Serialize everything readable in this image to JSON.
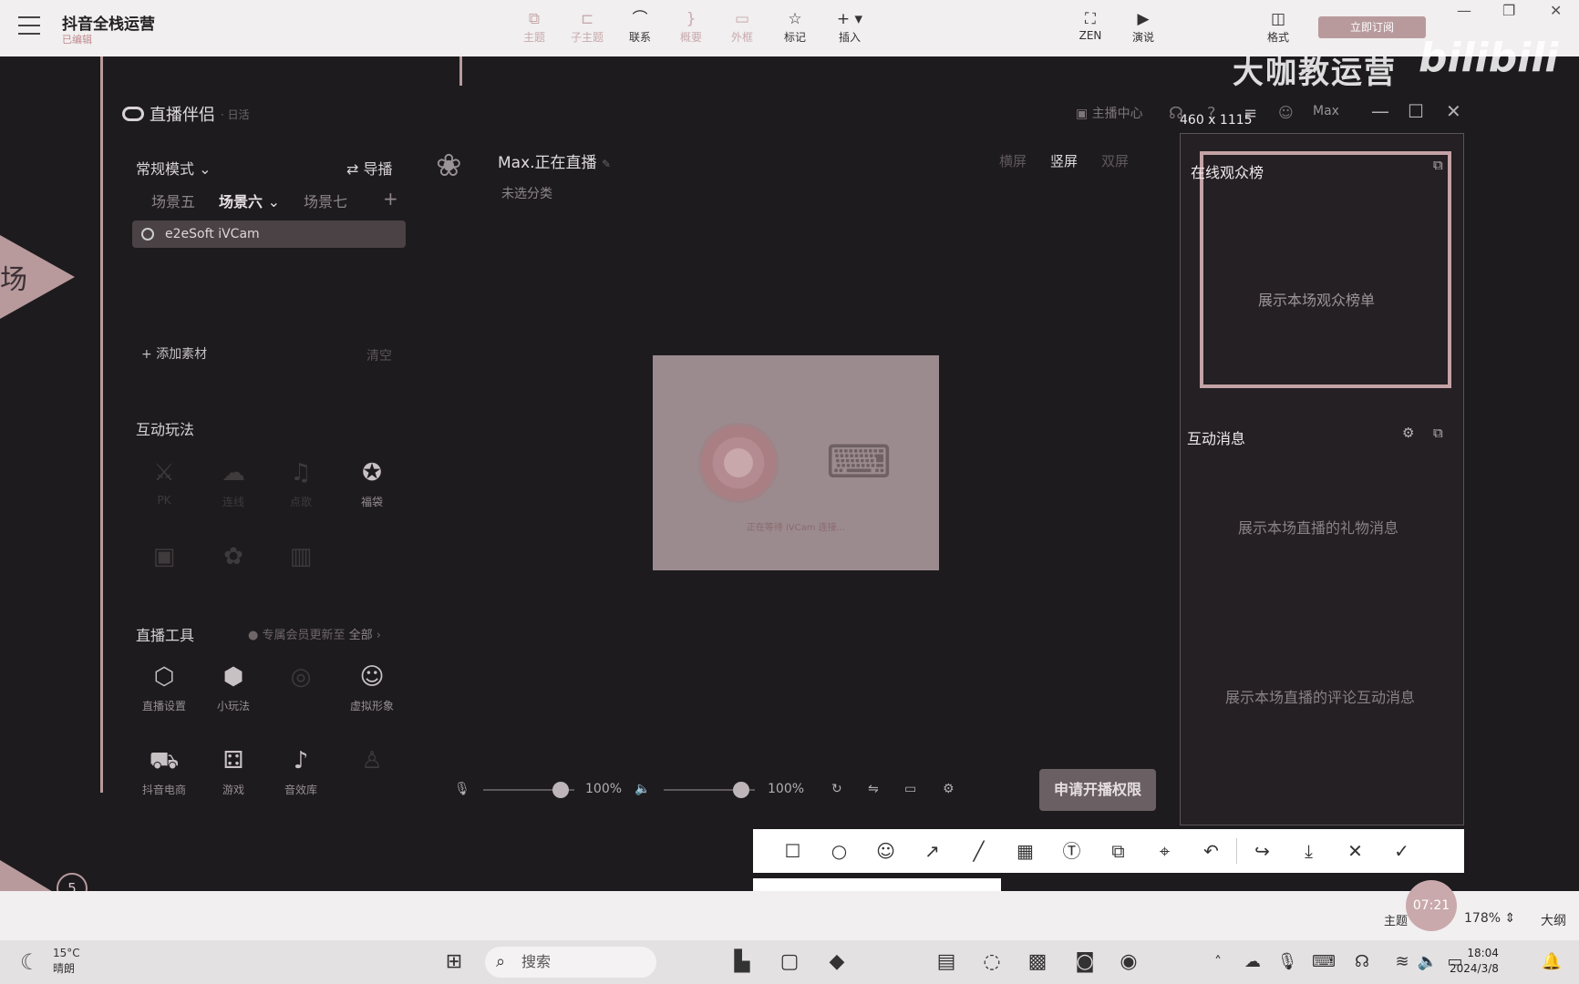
{
  "mindmap_app": {
    "title": "抖音全栈运营",
    "subtitle": "已编辑",
    "toolbar": [
      {
        "label": "主题",
        "icon": "topic-icon",
        "glyph": "⧉",
        "dim": true
      },
      {
        "label": "子主题",
        "icon": "subtopic-icon",
        "glyph": "⊏",
        "dim": true
      },
      {
        "label": "联系",
        "icon": "relation-icon",
        "glyph": "⌒",
        "dim": false
      },
      {
        "label": "概要",
        "icon": "summary-icon",
        "glyph": "}",
        "dim": true
      },
      {
        "label": "外框",
        "icon": "boundary-icon",
        "glyph": "▭",
        "dim": true
      },
      {
        "label": "标记",
        "icon": "marker-icon",
        "glyph": "☆",
        "dim": false
      },
      {
        "label": "插入",
        "icon": "insert-icon",
        "glyph": "+ ▾",
        "dim": false
      }
    ],
    "zen_label": "ZEN",
    "present_label": "演说",
    "format_label": "格式",
    "apply_button": "立即订阅"
  },
  "watermark": {
    "text": "大咖教运营",
    "brand": "bilibili"
  },
  "mindmap_canvas": {
    "node_char": "场",
    "node_number": "5"
  },
  "live_companion": {
    "title": "直播伴侣",
    "title_suffix": "· 日活",
    "anchor_center": "主播中心",
    "user": "Max",
    "size_label": "460 x 1115",
    "mode": "常规模式",
    "guide": "导播",
    "scenes": [
      "场景五",
      "场景六",
      "场景七"
    ],
    "active_scene": "场景六",
    "source": "e2eSoft iVCam",
    "add_material": "添加素材",
    "clear": "清空",
    "interactive_title": "互动玩法",
    "interactive_items": [
      {
        "label": "PK",
        "icon": "pk-icon",
        "glyph": "⚔",
        "faint": true
      },
      {
        "label": "连线",
        "icon": "link-icon",
        "glyph": "☁",
        "faint": true
      },
      {
        "label": "点歌",
        "icon": "music-icon",
        "glyph": "♫",
        "faint": true
      },
      {
        "label": "福袋",
        "icon": "lucky-bag-icon",
        "glyph": "✪",
        "faint": false
      },
      {
        "label": "",
        "icon": "card-icon",
        "glyph": "▣",
        "faint": true
      },
      {
        "label": "",
        "icon": "plant-icon",
        "glyph": "✿",
        "faint": true
      },
      {
        "label": "",
        "icon": "chart-icon",
        "glyph": "▥",
        "faint": true
      }
    ],
    "tools_title": "直播工具",
    "tools_note": "专属会员更新至",
    "tools_all": "全部",
    "tools": [
      {
        "label": "直播设置",
        "icon": "settings-icon",
        "glyph": "⬡",
        "faint": false
      },
      {
        "label": "小玩法",
        "icon": "mini-game-icon",
        "glyph": "⬢",
        "faint": false
      },
      {
        "label": "",
        "icon": "camera-icon",
        "glyph": "◎",
        "faint": true
      },
      {
        "label": "虚拟形象",
        "icon": "avatar-icon",
        "glyph": "☺",
        "faint": false
      },
      {
        "label": "抖音电商",
        "icon": "cart-icon",
        "glyph": "🛒",
        "faint": false
      },
      {
        "label": "游戏",
        "icon": "gamepad-icon",
        "glyph": "🎮",
        "faint": false
      },
      {
        "label": "音效库",
        "icon": "sound-icon",
        "glyph": "♪",
        "faint": false
      },
      {
        "label": "",
        "icon": "people-icon",
        "glyph": "♙",
        "faint": true
      }
    ],
    "live_status": "Max.正在直播",
    "category": "未选分类",
    "orientations": [
      "横屏",
      "竖屏",
      "双屏"
    ],
    "active_orientation": "竖屏",
    "preview_waiting": "正在等待 iVCam 连接...",
    "mic_volume": "100%",
    "speaker_volume": "100%",
    "mic_level": 0.85,
    "speaker_level": 0.85,
    "start_button": "申请开播权限",
    "rank_title": "在线观众榜",
    "rank_empty": "展示本场观众榜单",
    "messages_title": "互动消息",
    "gift_empty": "展示本场直播的礼物消息",
    "comment_empty": "展示本场直播的评论互动消息"
  },
  "status_bar": {
    "theme": "主题",
    "zoom": "178%",
    "outline": "大纲",
    "timer": "07:21"
  },
  "taskbar": {
    "temp": "15°C",
    "weather": "晴朗",
    "search": "搜索",
    "time": "18:04",
    "date": "2024/3/8"
  },
  "colors": {
    "accent": "#c4a2a6",
    "background": "#1d1b1e",
    "button": "#6a5f62"
  }
}
